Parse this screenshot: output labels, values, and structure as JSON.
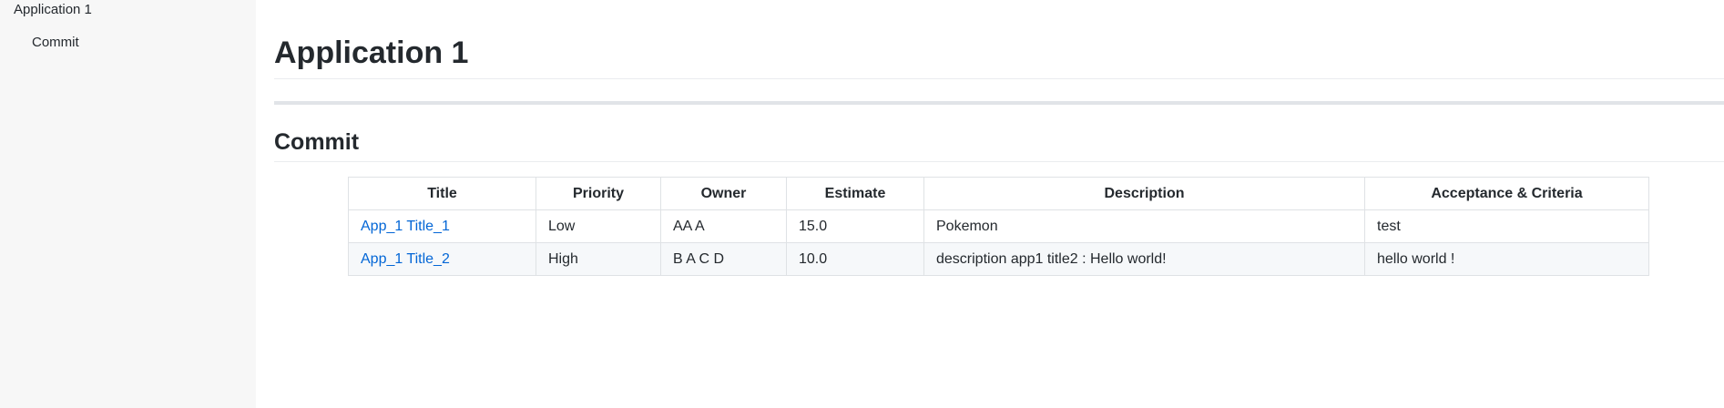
{
  "sidebar": {
    "app_label": "Application 1",
    "items": [
      {
        "label": "Commit"
      }
    ]
  },
  "main": {
    "title": "Application 1",
    "section_title": "Commit",
    "table": {
      "headers": [
        "Title",
        "Priority",
        "Owner",
        "Estimate",
        "Description",
        "Acceptance & Criteria"
      ],
      "rows": [
        [
          "App_1 Title_1",
          "Low",
          "AA A",
          "15.0",
          "Pokemon",
          "test"
        ],
        [
          "App_1 Title_2",
          "High",
          "B A C D",
          "10.0",
          "description app1 title2 : Hello world!",
          "hello world !"
        ]
      ]
    }
  },
  "colors": {
    "link": "#0366d6",
    "sidebar_bg": "#f7f7f7",
    "border": "#dfe2e5",
    "stripe": "#f6f8fa"
  }
}
